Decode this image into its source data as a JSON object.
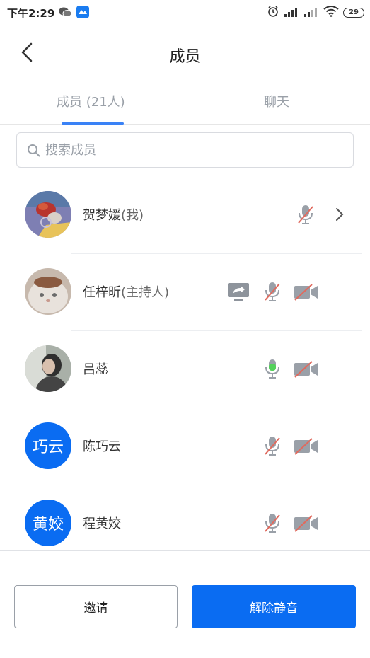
{
  "status_bar": {
    "time": "下午2:29",
    "battery": "29"
  },
  "header": {
    "title": "成员"
  },
  "tabs": [
    {
      "label": "成员 (21人)",
      "active": true
    },
    {
      "label": "聊天",
      "active": false
    }
  ],
  "search": {
    "placeholder": "搜索成员",
    "value": ""
  },
  "members": [
    {
      "name": "贺梦媛",
      "tag": "(我)",
      "avatar": "photo",
      "mic": "muted",
      "camera": "none",
      "share": false,
      "arrow": true
    },
    {
      "name": "任梓昕",
      "tag": "(主持人)",
      "avatar": "photo",
      "mic": "muted",
      "camera": "off",
      "share": true,
      "arrow": false
    },
    {
      "name": "吕蕊",
      "tag": "",
      "avatar": "photo",
      "mic": "active",
      "camera": "off",
      "share": false,
      "arrow": false
    },
    {
      "name": "陈巧云",
      "tag": "",
      "avatar_text": "巧云",
      "mic": "muted",
      "camera": "off",
      "share": false,
      "arrow": false
    },
    {
      "name": "程黄姣",
      "tag": "",
      "avatar_text": "黄姣",
      "mic": "muted",
      "camera": "off",
      "share": false,
      "arrow": false
    }
  ],
  "buttons": {
    "invite": "邀请",
    "unmute": "解除静音"
  },
  "colors": {
    "accent": "#0a6cf2",
    "tab_underline": "#3a82f6",
    "mute_slash": "#e06a5e",
    "mic_active": "#52d15a"
  }
}
